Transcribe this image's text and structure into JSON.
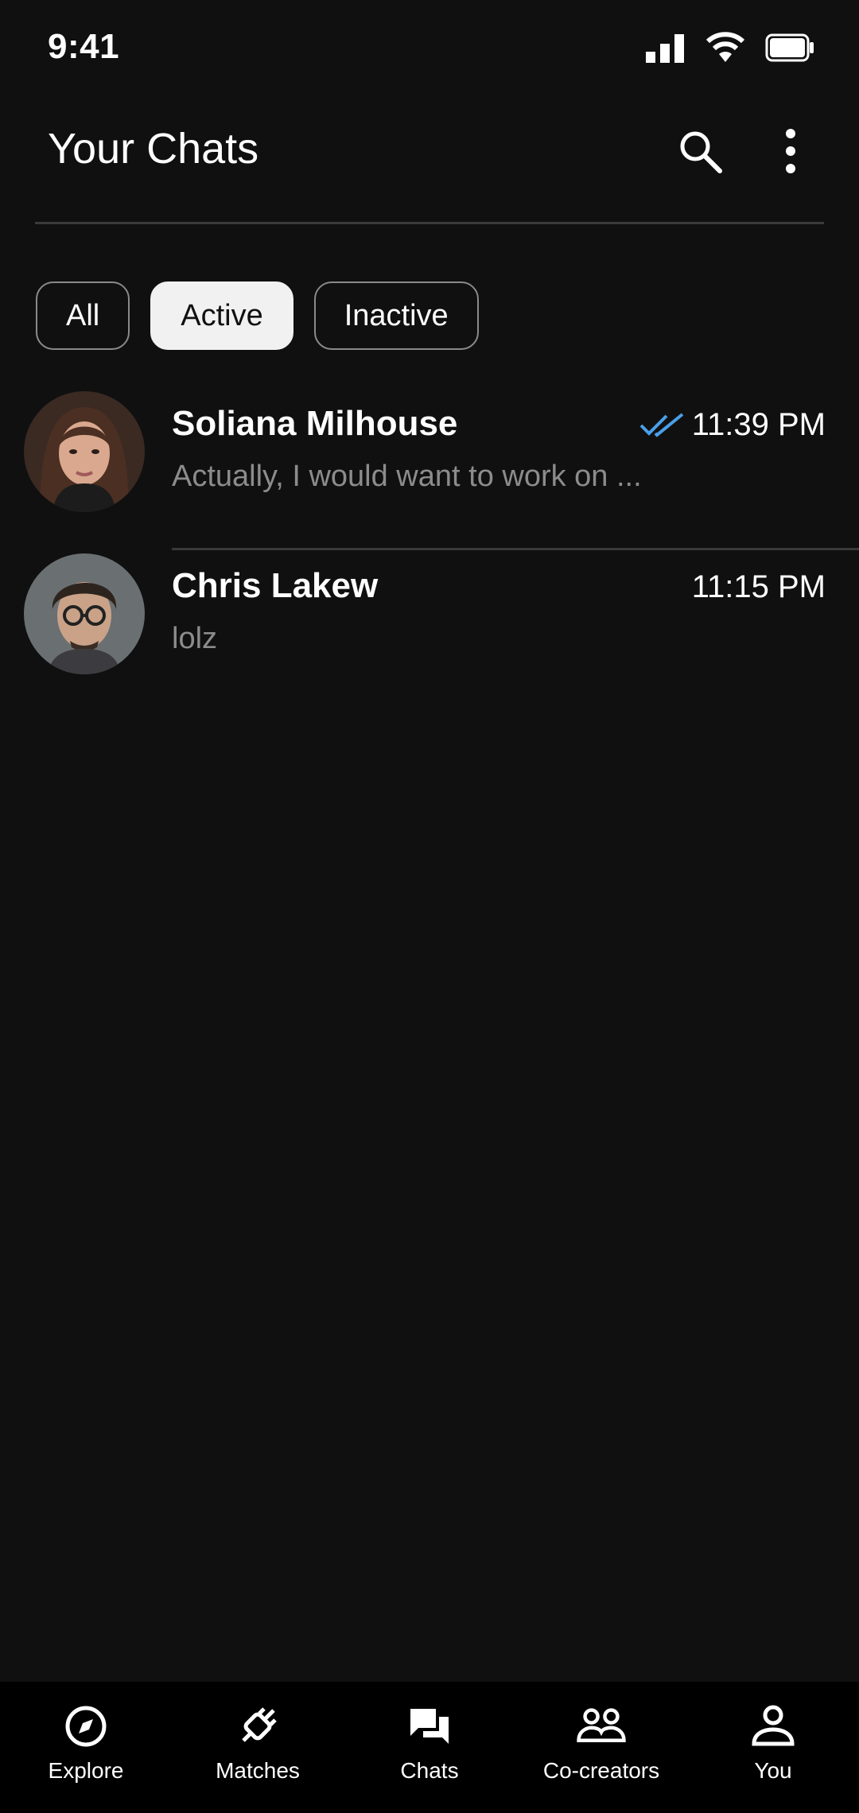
{
  "status_bar": {
    "time": "9:41",
    "icons": [
      "signal-icon",
      "wifi-icon",
      "battery-icon"
    ]
  },
  "header": {
    "title": "Your Chats",
    "icons": [
      "search-icon",
      "more-vertical-icon"
    ]
  },
  "filters": {
    "selected": "Active",
    "chips": [
      {
        "label": "All"
      },
      {
        "label": "Active"
      },
      {
        "label": "Inactive"
      }
    ]
  },
  "chats": [
    {
      "name": "Soliana Milhouse",
      "preview": "Actually, I would want to work on ...",
      "time": "11:39 PM",
      "read_receipt": "double-check-icon",
      "read_receipt_color": "#4a9fe8"
    },
    {
      "name": "Chris Lakew",
      "preview": "lolz",
      "time": "11:15 PM"
    }
  ],
  "bottom_nav": {
    "selected": "Chats",
    "items": [
      {
        "label": "Explore",
        "icon": "compass-icon"
      },
      {
        "label": "Matches",
        "icon": "plug-icon"
      },
      {
        "label": "Chats",
        "icon": "chat-bubbles-icon"
      },
      {
        "label": "Co-creators",
        "icon": "group-icon"
      },
      {
        "label": "You",
        "icon": "person-icon"
      }
    ]
  },
  "colors": {
    "background": "#101010",
    "nav_background": "#000000",
    "active_chip": "#f1f1f1",
    "preview_text": "#8c8c8c",
    "accent": "#4a9fe8"
  }
}
